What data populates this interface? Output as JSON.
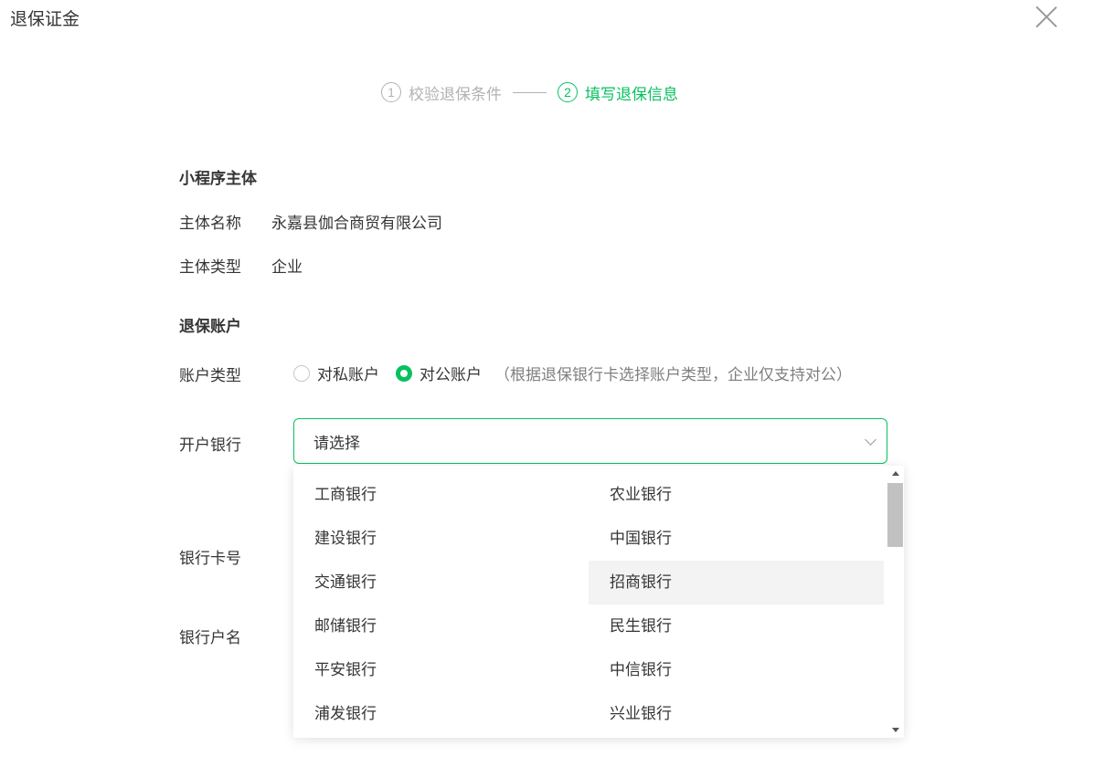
{
  "dialog": {
    "title": "退保证金"
  },
  "steps": [
    {
      "num": "1",
      "label": "校验退保条件",
      "active": false
    },
    {
      "num": "2",
      "label": "填写退保信息",
      "active": true
    }
  ],
  "subject_section": {
    "title": "小程序主体",
    "name_label": "主体名称",
    "name_value": "永嘉县伽合商贸有限公司",
    "type_label": "主体类型",
    "type_value": "企业"
  },
  "account_section": {
    "title": "退保账户",
    "account_type_label": "账户类型",
    "account_type_options": [
      "对私账户",
      "对公账户"
    ],
    "account_type_selected": "对公账户",
    "account_type_hint": "（根据退保银行卡选择账户类型，企业仅支持对公）",
    "bank_label": "开户银行",
    "bank_placeholder": "请选择",
    "card_label": "银行卡号",
    "account_name_label": "银行户名"
  },
  "bank_dropdown": {
    "options": [
      "工商银行",
      "农业银行",
      "建设银行",
      "中国银行",
      "交通银行",
      "招商银行",
      "邮储银行",
      "民生银行",
      "平安银行",
      "中信银行",
      "浦发银行",
      "兴业银行"
    ],
    "hovered": "招商银行"
  },
  "colors": {
    "accent": "#07c160",
    "text": "#353535",
    "muted": "#b2b2b2",
    "hint": "#7f7f7f"
  }
}
